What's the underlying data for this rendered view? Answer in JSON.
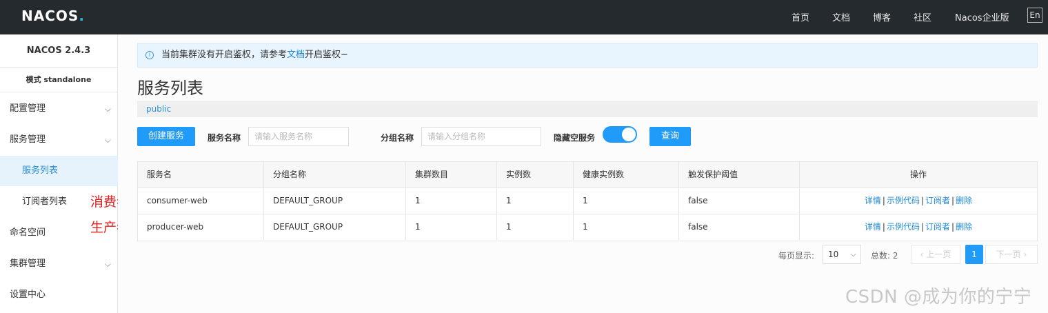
{
  "topbar": {
    "logo_text": "NACOS",
    "logo_dot": ".",
    "nav": [
      "首页",
      "文档",
      "博客",
      "社区",
      "Nacos企业版"
    ],
    "lang_button": "En"
  },
  "sidebar": {
    "version": "NACOS 2.4.3",
    "mode": "模式 standalone",
    "items": [
      {
        "label": "配置管理",
        "chevron": "⌵"
      },
      {
        "label": "服务管理",
        "chevron": "⌵"
      },
      {
        "label": "服务列表"
      },
      {
        "label": "订阅者列表"
      },
      {
        "label": "命名空间"
      },
      {
        "label": "集群管理",
        "chevron": "⌵"
      },
      {
        "label": "设置中心"
      }
    ]
  },
  "annotations": {
    "consumer": "消费者",
    "producer": "生产者"
  },
  "notice": {
    "prefix": "当前集群没有开启鉴权，请参考",
    "link": "文档",
    "suffix": "开启鉴权~"
  },
  "page_title": "服务列表",
  "namespace": "public",
  "search": {
    "create_button": "创建服务",
    "service_name_label": "服务名称",
    "service_name_placeholder": "请输入服务名称",
    "group_name_label": "分组名称",
    "group_name_placeholder": "请输入分组名称",
    "hide_empty_label": "隐藏空服务",
    "hide_empty_on": true,
    "query_button": "查询"
  },
  "table": {
    "headers": [
      "服务名",
      "分组名称",
      "集群数目",
      "实例数",
      "健康实例数",
      "触发保护阈值",
      "操作"
    ],
    "rows": [
      [
        "consumer-web",
        "DEFAULT_GROUP",
        "1",
        "1",
        "1",
        "false"
      ],
      [
        "producer-web",
        "DEFAULT_GROUP",
        "1",
        "1",
        "1",
        "false"
      ]
    ],
    "actions": [
      "详情",
      "示例代码",
      "订阅者",
      "删除"
    ],
    "action_separator": "|"
  },
  "pagination": {
    "page_size_label": "每页显示:",
    "page_size": "10",
    "total_label": "总数: 2",
    "prev": "上一页",
    "current": "1",
    "next": "下一页"
  },
  "watermark": "CSDN @成为你的宁宁",
  "colors": {
    "topbar_bg": "#252a2f",
    "primary": "#209bfa",
    "link": "#1e88d4",
    "annotation": "#e02020"
  }
}
